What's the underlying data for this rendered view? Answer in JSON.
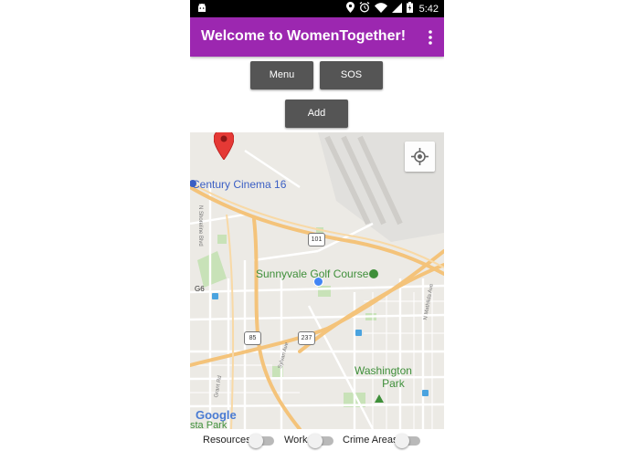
{
  "status_bar": {
    "time": "5:42",
    "icons": [
      "android-icon",
      "location-icon",
      "alarm-icon",
      "wifi-icon",
      "signal-icon",
      "battery-icon"
    ]
  },
  "app_bar": {
    "title": "Welcome to WomenTogether!",
    "background": "#9c27b0",
    "overflow_icon": "more-vert-icon"
  },
  "buttons": {
    "menu": "Menu",
    "sos": "SOS",
    "add": "Add"
  },
  "map": {
    "labels": {
      "cinema": "Century Cinema 16",
      "golf": "Sunnyvale Golf Course",
      "washington_line1": "Washington",
      "washington_line2": "Park",
      "park_partial": "sta Park",
      "g6": "G6",
      "shoreline": "N Shoreline Blvd",
      "sylvan": "Sylvan Ave",
      "mathilda": "N Mathilda Ave",
      "grant": "Grant Rd"
    },
    "shields": {
      "us101": "101",
      "ca85": "85",
      "ca237": "237"
    },
    "logo": "Google",
    "locate_icon": "my-location-icon",
    "marker_icon": "map-pin-icon"
  },
  "toggles": [
    {
      "label": "Resources",
      "on": false
    },
    {
      "label": "Work",
      "on": false
    },
    {
      "label": "Crime Areas",
      "on": false
    }
  ]
}
